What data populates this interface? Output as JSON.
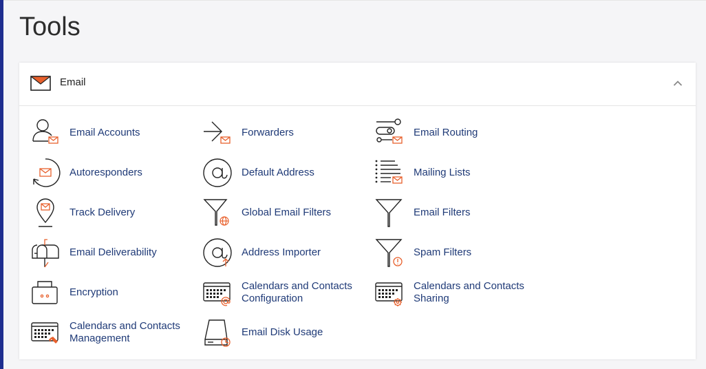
{
  "page": {
    "title": "Tools"
  },
  "section": {
    "title": "Email",
    "icon": "envelope-icon",
    "collapse_icon": "chevron-up-icon",
    "accent_color": "#e8602c",
    "link_color": "#1f3a77",
    "items": [
      {
        "label": "Email Accounts",
        "icon": "email-accounts-icon"
      },
      {
        "label": "Forwarders",
        "icon": "forwarders-icon"
      },
      {
        "label": "Email Routing",
        "icon": "email-routing-icon"
      },
      {
        "label": "Autoresponders",
        "icon": "autoresponders-icon"
      },
      {
        "label": "Default Address",
        "icon": "default-address-icon"
      },
      {
        "label": "Mailing Lists",
        "icon": "mailing-lists-icon"
      },
      {
        "label": "Track Delivery",
        "icon": "track-delivery-icon"
      },
      {
        "label": "Global Email Filters",
        "icon": "global-email-filters-icon"
      },
      {
        "label": "Email Filters",
        "icon": "email-filters-icon"
      },
      {
        "label": "Email Deliverability",
        "icon": "email-deliverability-icon"
      },
      {
        "label": "Address Importer",
        "icon": "address-importer-icon"
      },
      {
        "label": "Spam Filters",
        "icon": "spam-filters-icon"
      },
      {
        "label": "Encryption",
        "icon": "encryption-icon"
      },
      {
        "label": "Calendars and Contacts Configuration",
        "icon": "calendars-contacts-configuration-icon"
      },
      {
        "label": "Calendars and Contacts Sharing",
        "icon": "calendars-contacts-sharing-icon"
      },
      {
        "label": "Calendars and Contacts Management",
        "icon": "calendars-contacts-management-icon"
      },
      {
        "label": "Email Disk Usage",
        "icon": "email-disk-usage-icon"
      }
    ]
  }
}
